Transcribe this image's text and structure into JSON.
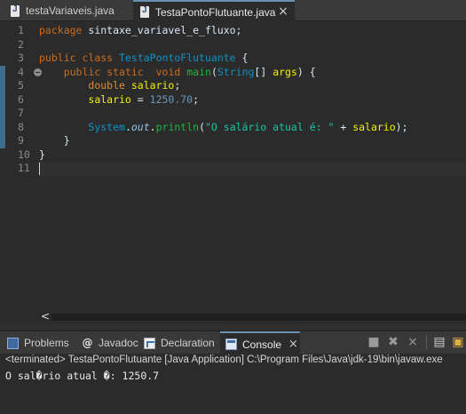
{
  "editor_tabs": [
    {
      "label": "testaVariaveis.java",
      "active": false
    },
    {
      "label": "TestaPontoFlutuante.java",
      "active": true
    }
  ],
  "editor": {
    "line_numbers": [
      "1",
      "2",
      "3",
      "4",
      "5",
      "6",
      "7",
      "8",
      "9",
      "10",
      "11"
    ],
    "lines": [
      [
        {
          "t": "package",
          "c": "kw"
        },
        {
          "t": " sintaxe_variavel_e_fluxo;",
          "c": "plain"
        }
      ],
      [],
      [
        {
          "t": "public",
          "c": "kw"
        },
        {
          "t": " ",
          "c": "plain"
        },
        {
          "t": "class",
          "c": "kw"
        },
        {
          "t": " ",
          "c": "plain"
        },
        {
          "t": "TestaPontoFlutuante",
          "c": "cls"
        },
        {
          "t": " {",
          "c": "plain"
        }
      ],
      [
        {
          "t": "    ",
          "c": "plain"
        },
        {
          "t": "public",
          "c": "kw"
        },
        {
          "t": " ",
          "c": "plain"
        },
        {
          "t": "static",
          "c": "kw"
        },
        {
          "t": "  ",
          "c": "plain"
        },
        {
          "t": "void",
          "c": "kw"
        },
        {
          "t": " ",
          "c": "plain"
        },
        {
          "t": "main",
          "c": "mth"
        },
        {
          "t": "(",
          "c": "plain"
        },
        {
          "t": "String",
          "c": "typ"
        },
        {
          "t": "[] ",
          "c": "plain"
        },
        {
          "t": "args",
          "c": "var"
        },
        {
          "t": ") {",
          "c": "plain"
        }
      ],
      [
        {
          "t": "        ",
          "c": "plain"
        },
        {
          "t": "double",
          "c": "kw2"
        },
        {
          "t": " ",
          "c": "plain"
        },
        {
          "t": "salario",
          "c": "var"
        },
        {
          "t": ";",
          "c": "plain"
        }
      ],
      [
        {
          "t": "        ",
          "c": "plain"
        },
        {
          "t": "salario",
          "c": "var"
        },
        {
          "t": " = ",
          "c": "plain"
        },
        {
          "t": "1250.70",
          "c": "num"
        },
        {
          "t": ";",
          "c": "plain"
        }
      ],
      [],
      [
        {
          "t": "        ",
          "c": "plain"
        },
        {
          "t": "System",
          "c": "typ"
        },
        {
          "t": ".",
          "c": "plain"
        },
        {
          "t": "out",
          "c": "fld"
        },
        {
          "t": ".",
          "c": "plain"
        },
        {
          "t": "println",
          "c": "mth"
        },
        {
          "t": "(",
          "c": "plain"
        },
        {
          "t": "\"O salário atual é: \"",
          "c": "str"
        },
        {
          "t": " + ",
          "c": "plain"
        },
        {
          "t": "salario",
          "c": "var"
        },
        {
          "t": ");",
          "c": "plain"
        }
      ],
      [
        {
          "t": "    }",
          "c": "plain"
        }
      ],
      [
        {
          "t": "}",
          "c": "plain"
        }
      ],
      []
    ]
  },
  "panel_tabs": [
    {
      "label": "Problems",
      "icon": "problems-icon",
      "active": false
    },
    {
      "label": "Javadoc",
      "icon": "javadoc-icon",
      "active": false
    },
    {
      "label": "Declaration",
      "icon": "declaration-icon",
      "active": false
    },
    {
      "label": "Console",
      "icon": "console-icon",
      "active": true
    }
  ],
  "console": {
    "header": "<terminated> TestaPontoFlutuante [Java Application] C:\\Program Files\\Java\\jdk-19\\bin\\javaw.exe",
    "output": "O sal�rio atual �: 1250.7"
  },
  "icons": {
    "close": "×",
    "scroll_left": "<",
    "javadoc": "@"
  }
}
